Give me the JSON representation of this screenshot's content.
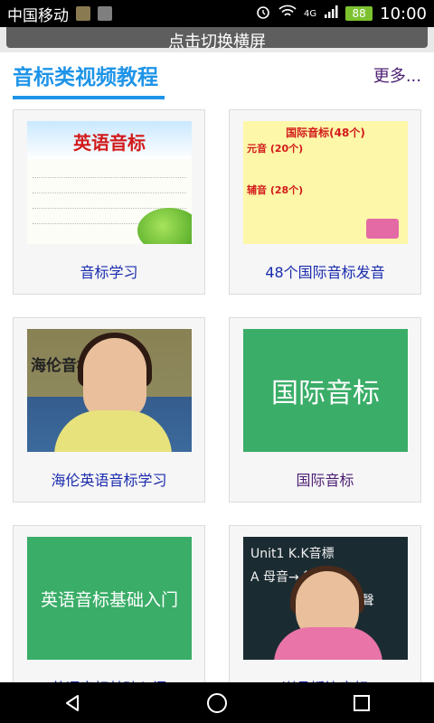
{
  "status_bar": {
    "carrier": "中国移动",
    "network": "4G",
    "battery": "88",
    "time": "10:00"
  },
  "topbar": {
    "landscape_label": "点击切换横屏"
  },
  "section": {
    "title": "音标类视频教程",
    "more": "更多..."
  },
  "cards": [
    {
      "label": "音标学习",
      "thumb_title": "英语音标",
      "thumb_type": "phonetic-chart"
    },
    {
      "label": "48个国际音标发音",
      "thumb_title": "国际音标(48个)",
      "vowel_tag": "元音 (20个)",
      "consonant_tag": "辅音 (28个)",
      "thumb_type": "ipa-table"
    },
    {
      "label": "海伦英语音标学习",
      "thumb_title": "海伦音标",
      "thumb_type": "video-teacher"
    },
    {
      "label": "国际音标",
      "thumb_title": "国际音标",
      "thumb_type": "green-tile"
    },
    {
      "label": "英语音标基础入门",
      "thumb_title": "英语音标基础入门",
      "thumb_type": "green-tile"
    },
    {
      "label": "谢孟媛比音标",
      "thumb_title": "Unit1 K.K音標",
      "thumb_line2": "A 母音→ 輕聲",
      "thumb_line3": "音:四聲",
      "thumb_type": "blackboard"
    }
  ],
  "colors": {
    "accent": "#1e94e8",
    "link": "#1b2cae",
    "visited": "#4c1e73",
    "tile_green": "#3aad68"
  }
}
